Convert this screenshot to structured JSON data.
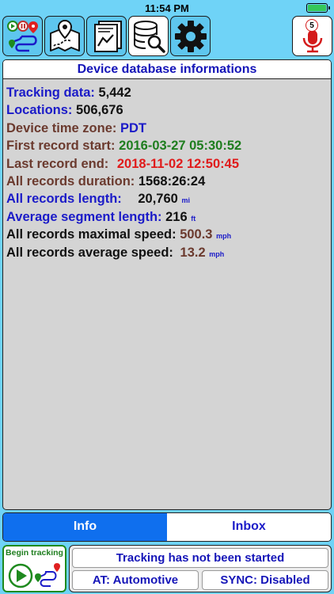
{
  "statusbar": {
    "time": "11:54 PM"
  },
  "toolbar": {
    "icons": [
      "tracks-icon",
      "map-route-icon",
      "report-chart-icon",
      "database-search-icon",
      "settings-gear-icon",
      "microphone-icon"
    ],
    "mic_badge": "5",
    "active_index": 3
  },
  "panel": {
    "title": "Device database informations",
    "rows": [
      {
        "label": "Tracking data:",
        "value": "5,442",
        "unit": ""
      },
      {
        "label": "Locations:",
        "value": "506,676",
        "unit": ""
      },
      {
        "label": "Device time zone:",
        "value": "PDT",
        "unit": ""
      },
      {
        "label": "First record start:",
        "value": "2016-03-27 05:30:52",
        "unit": ""
      },
      {
        "label": "Last record end:",
        "value": "2018-11-02 12:50:45",
        "unit": ""
      },
      {
        "label": "All records duration:",
        "value": "1568:26:24",
        "unit": ""
      },
      {
        "label": "All records length:",
        "value": "20,760",
        "unit": "mi"
      },
      {
        "label": "Average segment length:",
        "value": "216",
        "unit": "ft"
      },
      {
        "label": "All records maximal speed:",
        "value": "500.3",
        "unit": "mph"
      },
      {
        "label": "All records average speed:",
        "value": "13.2",
        "unit": "mph"
      }
    ]
  },
  "tabs": [
    {
      "label": "Info",
      "active": true
    },
    {
      "label": "Inbox",
      "active": false
    }
  ],
  "bottom": {
    "begin_label": "Begin tracking",
    "status_text": "Tracking has not been started",
    "activity": "AT: Automotive",
    "sync": "SYNC: Disabled"
  },
  "colors": {
    "background": "#6fd3f7",
    "title_blue": "#1515b8",
    "tab_active": "#0f6fee",
    "value_green": "#1e7d1e",
    "value_red": "#e01b1b",
    "label_brown": "#6b3a2e"
  }
}
